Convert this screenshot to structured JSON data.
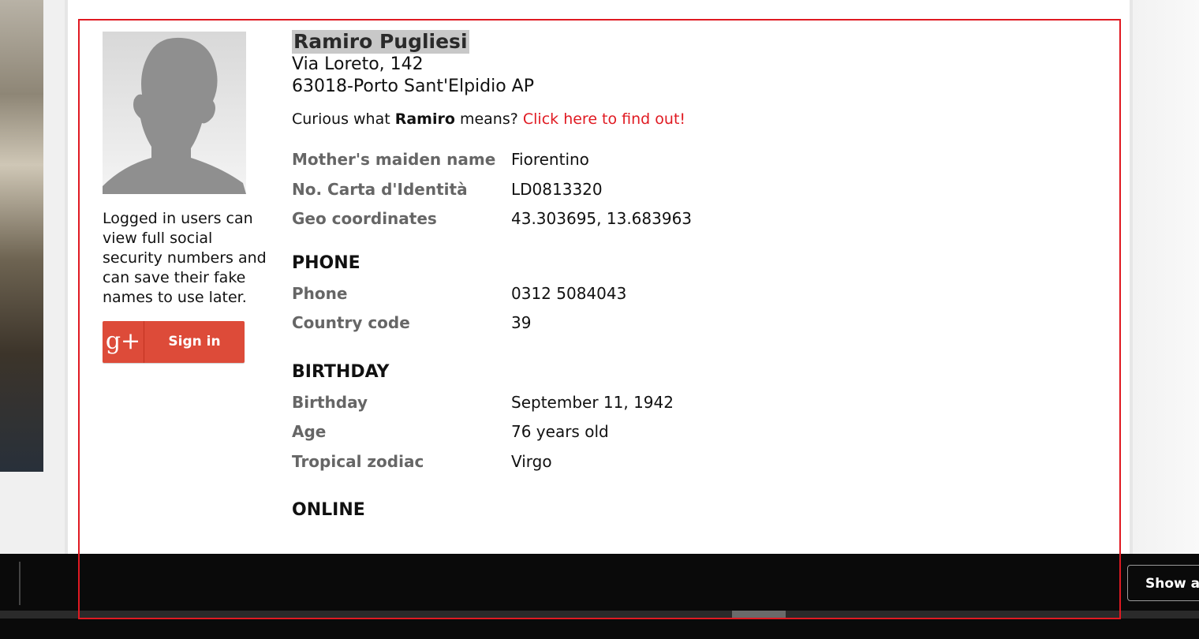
{
  "person": {
    "name": "Ramiro Pugliesi",
    "address_line1": "Via Loreto, 142",
    "address_line2": "63018-Porto Sant'Elpidio AP"
  },
  "curious": {
    "prefix": "Curious what",
    "first_name": "Ramiro",
    "suffix": "means?",
    "link": "Click here to find out!"
  },
  "details": [
    {
      "label": "Mother's maiden name",
      "value": "Fiorentino"
    },
    {
      "label": "No. Carta d'Identità",
      "value": "LD0813320"
    },
    {
      "label": "Geo coordinates",
      "value": "43.303695, 13.683963"
    }
  ],
  "phone_section": {
    "title": "PHONE",
    "rows": [
      {
        "label": "Phone",
        "value": "0312 5084043"
      },
      {
        "label": "Country code",
        "value": "39"
      }
    ]
  },
  "birthday_section": {
    "title": "BIRTHDAY",
    "rows": [
      {
        "label": "Birthday",
        "value": "September 11, 1942"
      },
      {
        "label": "Age",
        "value": "76 years old"
      },
      {
        "label": "Tropical zodiac",
        "value": "Virgo"
      }
    ]
  },
  "online_section": {
    "title": "ONLINE"
  },
  "sidebar": {
    "login_note": "Logged in users can view full social security numbers and can save their fake names to use later.",
    "gplus_icon_text": "g+",
    "signin_label": "Sign in"
  },
  "taskbar": {
    "show_all_label": "Show all"
  },
  "colors": {
    "accent_red": "#e01a22",
    "gplus_red": "#dd4b39",
    "label_gray": "#666666"
  }
}
